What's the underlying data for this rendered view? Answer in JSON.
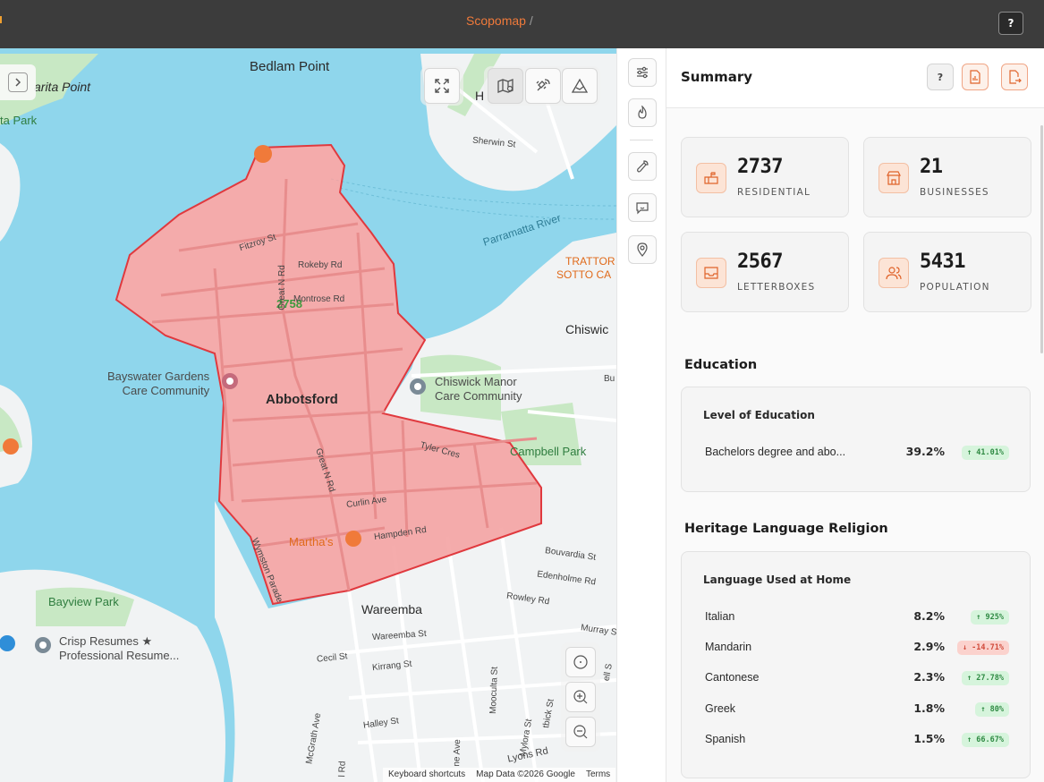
{
  "topbar": {
    "brand": "Scopomap",
    "separator": "/",
    "help": "?"
  },
  "map": {
    "labels": {
      "bedlam_point": "Bedlam Point",
      "marita_point": "arita Point",
      "ta_park": "ta Park",
      "h": "H",
      "sherwin_st": "Sherwin St",
      "parramatta_river": "Parramatta River",
      "trattoria": "TRATTOR",
      "sotto": "SOTTO CA",
      "chiswick": "Chiswic",
      "chiswick_manor_1": "Chiswick Manor",
      "chiswick_manor_2": "Care Community",
      "bayswater_1": "Bayswater Gardens",
      "bayswater_2": "Care Community",
      "abbotsford": "Abbotsford",
      "postcode": "2758",
      "fitzroy_st": "Fitzroy St",
      "rokeby_rd": "Rokeby Rd",
      "montrose_rd": "Montrose Rd",
      "great_n_rd_1": "Great N Rd",
      "great_n_rd_2": "Great N Rd",
      "tyler_cres": "Tyler Cres",
      "curlin_ave": "Curlin Ave",
      "campbell_park": "Campbell Park",
      "marthas": "Martha's",
      "hampden_rd": "Hampden Rd",
      "bouvardia_st": "Bouvardia St",
      "edenholme_rd": "Edenholme Rd",
      "rowley_rd": "Rowley Rd",
      "murray_s": "Murray S",
      "wymston_parade": "Wymston Parade",
      "bayview_park": "Bayview Park",
      "wareemba": "Wareemba",
      "wareemba_st": "Wareemba St",
      "cecil_st": "Cecil St",
      "kirrang_st": "Kirrang St",
      "crisp_1": "Crisp Resumes ★",
      "crisp_2": "Professional Resume...",
      "halley_st": "Halley St",
      "mcgrath_ave": "McGrath Ave",
      "mooculta_st": "Mooculta St",
      "mylora_st": "Mylora St",
      "lyons_rd": "Lyons Rd",
      "ne_ave": "ne Ave",
      "bu": "Bu",
      "ell_s": "ell S",
      "sbick_st": "tbick St",
      "n_rd": "l Rd"
    },
    "footer": {
      "shortcuts": "Keyboard shortcuts",
      "data": "Map Data ©2026 Google",
      "terms": "Terms"
    },
    "colors": {
      "water": "#8fd6ec",
      "land": "#f1f3f4",
      "park": "#c8e8c4",
      "boundary_fill": "#f4a3a3",
      "boundary_stroke": "#e0393e"
    }
  },
  "panel": {
    "title": "Summary",
    "help": "?",
    "stats": [
      {
        "value": "2737",
        "label": "RESIDENTIAL",
        "icon": "mailbox-icon"
      },
      {
        "value": "21",
        "label": "BUSINESSES",
        "icon": "store-icon"
      },
      {
        "value": "2567",
        "label": "LETTERBOXES",
        "icon": "inbox-icon"
      },
      {
        "value": "5431",
        "label": "POPULATION",
        "icon": "users-icon"
      }
    ],
    "education": {
      "title": "Education",
      "card_title": "Level of Education",
      "rows": [
        {
          "name": "Bachelors degree and abo...",
          "pct": "39.2%",
          "change": "↑ 41.01%",
          "dir": "up"
        }
      ]
    },
    "heritage": {
      "title": "Heritage Language Religion",
      "card_title": "Language Used at Home",
      "rows": [
        {
          "name": "Italian",
          "pct": "8.2%",
          "change": "↑ 925%",
          "dir": "up"
        },
        {
          "name": "Mandarin",
          "pct": "2.9%",
          "change": "↓ -14.71%",
          "dir": "down"
        },
        {
          "name": "Cantonese",
          "pct": "2.3%",
          "change": "↑ 27.78%",
          "dir": "up"
        },
        {
          "name": "Greek",
          "pct": "1.8%",
          "change": "↑ 80%",
          "dir": "up"
        },
        {
          "name": "Spanish",
          "pct": "1.5%",
          "change": "↑ 66.67%",
          "dir": "up"
        }
      ]
    },
    "colors": {
      "accent": "#f07a3a",
      "up": "#2f8a43",
      "down": "#d04a3a"
    }
  }
}
